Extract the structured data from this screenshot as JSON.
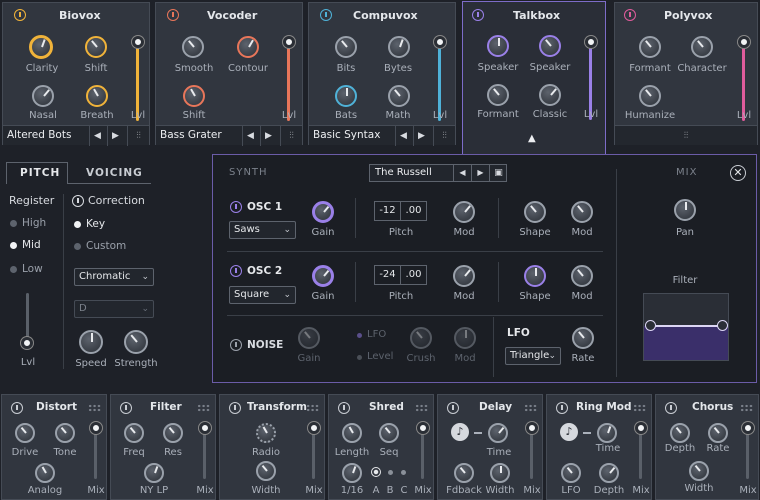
{
  "top_panels": [
    {
      "title": "Biovox",
      "accent": "#f0b33a",
      "knobs": [
        "Clarity",
        "Shift",
        "Nasal",
        "Breath"
      ],
      "slider_label": "Lvl",
      "preset": "Altered Bots"
    },
    {
      "title": "Vocoder",
      "accent": "#e8765a",
      "knobs": [
        "Smooth",
        "Contour",
        "Shift"
      ],
      "slider_label": "Lvl",
      "preset": "Bass Grater"
    },
    {
      "title": "Compuvox",
      "accent": "#4fb2d8",
      "knobs": [
        "Bits",
        "Bytes",
        "Bats",
        "Math"
      ],
      "slider_label": "Lvl",
      "preset": "Basic Syntax"
    },
    {
      "title": "Talkbox",
      "accent": "#9a80e8",
      "knobs": [
        "Speaker",
        "Speaker",
        "Formant",
        "Classic"
      ],
      "slider_label": "Lvl"
    },
    {
      "title": "Polyvox",
      "accent": "#e05c9c",
      "knobs": [
        "Formant",
        "Character",
        "Humanize"
      ],
      "slider_label": "Lvl"
    }
  ],
  "side": {
    "tabs": [
      "PITCH",
      "VOICING"
    ],
    "register_title": "Register",
    "register_options": [
      "High",
      "Mid",
      "Low"
    ],
    "correction_title": "Correction",
    "correction_options": [
      "Key",
      "Custom"
    ],
    "scale": "Chromatic",
    "key": "D",
    "lvl": "Lvl",
    "speed": "Speed",
    "strength": "Strength"
  },
  "synth": {
    "title": "SYNTH",
    "preset": "The Russell",
    "mix_title": "MIX",
    "osc1": {
      "name": "OSC 1",
      "wave": "Saws",
      "gain": "Gain",
      "pitch_a": "-12",
      "pitch_b": ".00",
      "pitch": "Pitch",
      "mod": "Mod",
      "shape": "Shape",
      "mod2": "Mod"
    },
    "osc2": {
      "name": "OSC 2",
      "wave": "Square",
      "gain": "Gain",
      "pitch_a": "-24",
      "pitch_b": ".00",
      "pitch": "Pitch",
      "mod": "Mod",
      "shape": "Shape",
      "mod2": "Mod"
    },
    "noise": {
      "name": "NOISE",
      "gain": "Gain",
      "lfo": "LFO",
      "level": "Level",
      "crush": "Crush",
      "mod": "Mod"
    },
    "lfo": {
      "title": "LFO",
      "wave": "Triangle",
      "rate": "Rate"
    },
    "pan": "Pan",
    "filter": "Filter"
  },
  "fx": [
    {
      "title": "Distort",
      "labels": [
        "Drive",
        "Tone",
        "Analog",
        "Mix"
      ]
    },
    {
      "title": "Filter",
      "labels": [
        "Freq",
        "Res",
        "NY LP",
        "Mix"
      ]
    },
    {
      "title": "Transform",
      "labels": [
        "Radio",
        "Width",
        "Mix"
      ]
    },
    {
      "title": "Shred",
      "labels": [
        "Length",
        "Seq",
        "1/16",
        "A",
        "B",
        "C",
        "Mix"
      ]
    },
    {
      "title": "Delay",
      "labels": [
        "Time",
        "Fdback",
        "Width",
        "Mix"
      ]
    },
    {
      "title": "Ring Mod",
      "labels": [
        "Time",
        "LFO",
        "Depth",
        "Mix"
      ]
    },
    {
      "title": "Chorus",
      "labels": [
        "Depth",
        "Rate",
        "Width",
        "Mix"
      ]
    }
  ],
  "icons": {
    "power": "power-icon",
    "prev": "arrow-left-icon",
    "next": "arrow-right-icon",
    "mixer": "mixer-icon",
    "save": "save-icon",
    "close": "close-icon",
    "note": "note-icon",
    "dots": "drag-dots-icon"
  },
  "colors": {
    "synth_accent": "#7d6cc8",
    "bg": "#1e2128",
    "panel": "#31363f"
  }
}
